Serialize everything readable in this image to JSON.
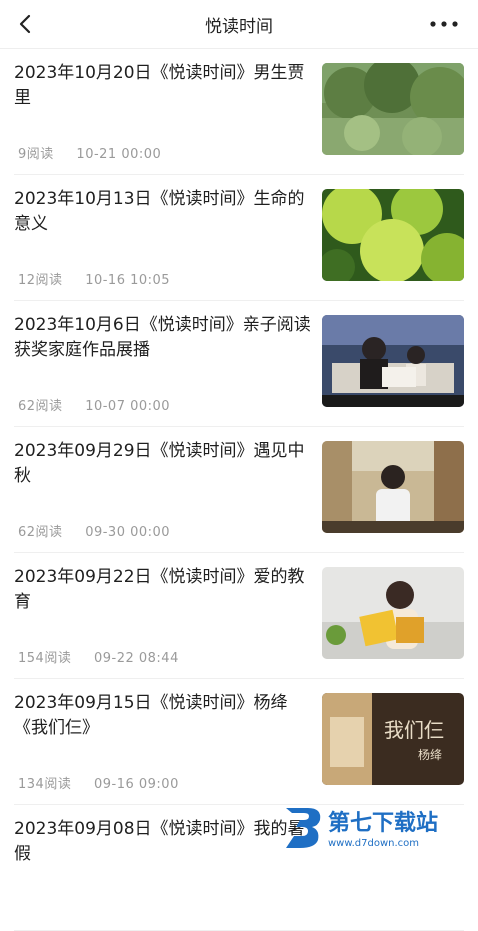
{
  "header": {
    "title": "悦读时间",
    "back_icon": "chevron-left-icon",
    "more_icon": "more-dots-icon"
  },
  "articles": [
    {
      "title": "2023年10月20日《悦读时间》男生贾里",
      "views": "9阅读",
      "time": "10-21  00:00"
    },
    {
      "title": "2023年10月13日《悦读时间》生命的意义",
      "views": "12阅读",
      "time": "10-16  10:05"
    },
    {
      "title": "2023年10月6日《悦读时间》亲子阅读获奖家庭作品展播",
      "views": "62阅读",
      "time": "10-07  00:00"
    },
    {
      "title": "2023年09月29日《悦读时间》遇见中秋",
      "views": "62阅读",
      "time": "09-30  00:00"
    },
    {
      "title": "2023年09月22日《悦读时间》爱的教育",
      "views": "154阅读",
      "time": "09-22  08:44"
    },
    {
      "title": "2023年09月15日《悦读时间》杨绛《我们仨》",
      "views": "134阅读",
      "time": "09-16  09:00"
    },
    {
      "title": "2023年09月08日《悦读时间》我的暑假",
      "views": "",
      "time": ""
    }
  ],
  "thumbnails": {
    "thumb_6_text_main": "我们仨",
    "thumb_6_text_author": "杨绛"
  },
  "watermark": {
    "name": "第七下载站",
    "url": "www.d7down.com"
  }
}
